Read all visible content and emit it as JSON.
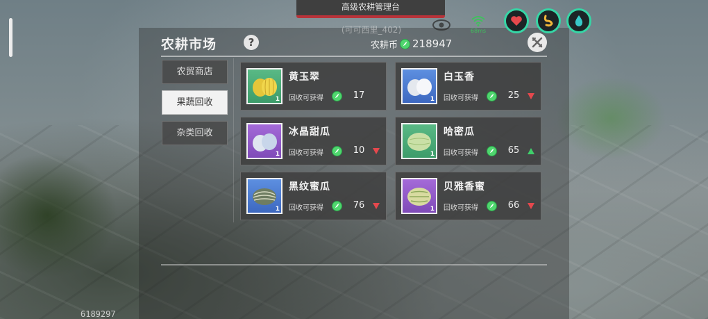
{
  "hud": {
    "top_title": "高级农耕管理台",
    "subtitle": "(可可西里_402)",
    "ping": "68ms",
    "accent_color": "#36d6a6"
  },
  "panel": {
    "title": "农耕市场",
    "help_label": "?",
    "currency_label": "农耕币",
    "currency_value": "218947",
    "close_icon": "close-icon"
  },
  "nav": {
    "items": [
      {
        "label": "农贸商店",
        "active": false
      },
      {
        "label": "果蔬回收",
        "active": true
      },
      {
        "label": "杂类回收",
        "active": false
      }
    ]
  },
  "items": [
    {
      "name": "黄玉翠",
      "recv_label": "回收可获得",
      "amount": "17",
      "trend": "none",
      "bg": "green",
      "qty": "1"
    },
    {
      "name": "白玉香",
      "recv_label": "回收可获得",
      "amount": "25",
      "trend": "down",
      "bg": "blue",
      "qty": "1"
    },
    {
      "name": "冰晶甜瓜",
      "recv_label": "回收可获得",
      "amount": "10",
      "trend": "down",
      "bg": "purple",
      "qty": "1"
    },
    {
      "name": "哈密瓜",
      "recv_label": "回收可获得",
      "amount": "65",
      "trend": "up",
      "bg": "green",
      "qty": "1"
    },
    {
      "name": "黑纹蜜瓜",
      "recv_label": "回收可获得",
      "amount": "76",
      "trend": "down",
      "bg": "blue",
      "qty": "1"
    },
    {
      "name": "贝雅香蜜",
      "recv_label": "回收可获得",
      "amount": "66",
      "trend": "down",
      "bg": "purple",
      "qty": "1"
    }
  ],
  "footer": {
    "player_id": "6189297"
  },
  "colors": {
    "trend_up": "#3fcf6a",
    "trend_down": "#e5484d",
    "coin": "#4fd66e"
  }
}
